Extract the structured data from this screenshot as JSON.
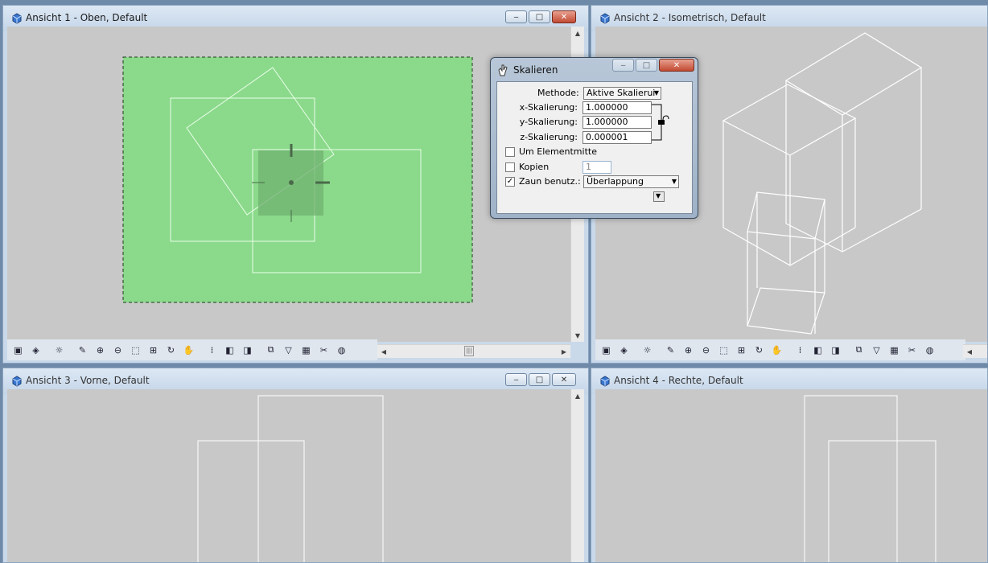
{
  "windows": [
    {
      "title": "Ansicht 1 - Oben, Default"
    },
    {
      "title": "Ansicht 2 - Isometrisch, Default"
    },
    {
      "title": "Ansicht 3 - Vorne, Default"
    },
    {
      "title": "Ansicht 4 - Rechte, Default"
    }
  ],
  "caption_buttons": {
    "minimize": "‒",
    "maximize": "□",
    "close": "✕"
  },
  "toolbar_icons": [
    "view-attributes-icon",
    "levels-icon",
    "display-style-icon",
    "update-icon",
    "zoom-in-icon",
    "zoom-out-icon",
    "window-area-icon",
    "fit-view-icon",
    "rotate-icon",
    "pan-icon",
    "walk-icon",
    "view-previous-icon",
    "view-next-icon",
    "copy-view-icon",
    "clip-volume-icon",
    "clip-mask-icon",
    "camera-icon",
    "render-icon"
  ],
  "scroll_glyphs": {
    "up": "▲",
    "down": "▼",
    "left": "◀",
    "right": "▶",
    "thumb": "|||"
  },
  "dialog": {
    "title": "Skalieren",
    "methode_label": "Methode:",
    "methode_value": "Aktive Skalierui",
    "x_label": "x-Skalierung:",
    "x_value": "1.000000",
    "y_label": "y-Skalierung:",
    "y_value": "1.000000",
    "z_label": "z-Skalierung:",
    "z_value": "0.000001",
    "um_elementmitte_label": "Um Elementmitte",
    "um_elementmitte_checked": false,
    "kopien_label": "Kopien",
    "kopien_checked": false,
    "kopien_value": "1",
    "zaun_label": "Zaun benutz.:",
    "zaun_checked": true,
    "zaun_value": "Überlappung",
    "check_mark": "✓",
    "dropdown_arrow": "▼"
  },
  "colors": {
    "fence_fill": "#8bd98b",
    "fence_border": "#1a3a1a",
    "viewport_bg": "#c8c8c8",
    "geometry": "#ffffff"
  }
}
